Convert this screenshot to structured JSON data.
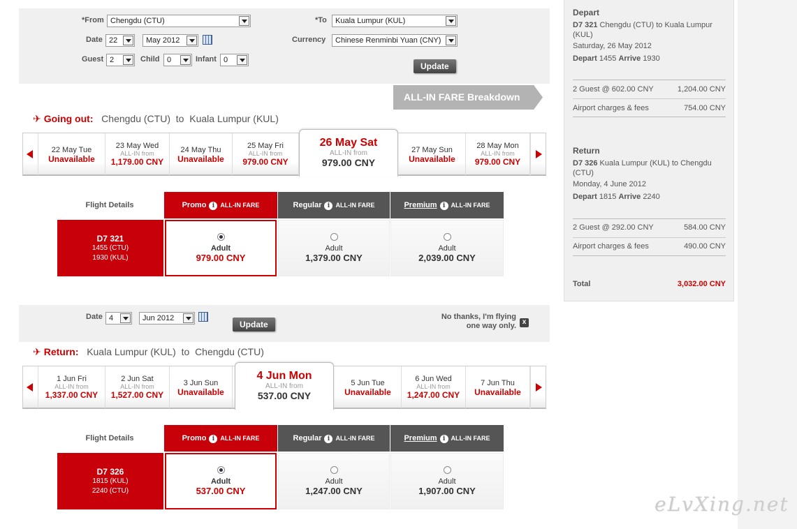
{
  "search": {
    "from_label": "*From",
    "from_value": "Chengdu (CTU)",
    "to_label": "*To",
    "to_value": "Kuala Lumpur (KUL)",
    "date_label": "Date",
    "date_day": "22",
    "date_month": "May 2012",
    "currency_label": "Currency",
    "currency_value": "Chinese Renminbi Yuan (CNY)",
    "guest_label": "Guest",
    "guest_value": "2",
    "child_label": "Child",
    "child_value": "0",
    "infant_label": "Infant",
    "infant_value": "0",
    "update": "Update"
  },
  "breakdown": "ALL-IN FARE Breakdown",
  "outbound": {
    "dir": "Going out:",
    "from": "Chengdu (CTU)",
    "to_word": "to",
    "to": "Kuala Lumpur (KUL)",
    "days": [
      {
        "d": "22 May Tue",
        "status": "Unavailable"
      },
      {
        "d": "23 May Wed",
        "af": "ALL-IN from",
        "price": "1,179.00 CNY"
      },
      {
        "d": "24 May Thu",
        "status": "Unavailable"
      },
      {
        "d": "25 May Fri",
        "af": "ALL-IN from",
        "price": "979.00 CNY"
      },
      {
        "d": "26 May Sat",
        "af": "ALL-IN from",
        "price": "979.00 CNY"
      },
      {
        "d": "27 May Sun",
        "status": "Unavailable"
      },
      {
        "d": "28 May Mon",
        "af": "ALL-IN from",
        "price": "979.00 CNY"
      }
    ],
    "flight_details": "Flight Details",
    "fares": [
      {
        "name": "Promo",
        "tag": "ALL-IN FARE"
      },
      {
        "name": "Regular",
        "tag": "ALL-IN FARE"
      },
      {
        "name": "Premium",
        "tag": "ALL-IN FARE"
      }
    ],
    "flight": {
      "no": "D7  321",
      "dep": "1455  (CTU)",
      "arr": "1930  (KUL)"
    },
    "cells": [
      {
        "pax": "Adult",
        "price": "979.00 CNY"
      },
      {
        "pax": "Adult",
        "price": "1,379.00 CNY"
      },
      {
        "pax": "Adult",
        "price": "2,039.00 CNY"
      }
    ]
  },
  "return_search": {
    "date_label": "Date",
    "date_day": "4",
    "date_month": "Jun 2012",
    "update": "Update",
    "no_thanks_1": "No thanks, I'm flying",
    "no_thanks_2": "one way only.",
    "close": "x"
  },
  "inbound": {
    "dir": "Return:",
    "from": "Kuala Lumpur (KUL)",
    "to_word": "to",
    "to": "Chengdu (CTU)",
    "days": [
      {
        "d": "1 Jun Fri",
        "af": "ALL-IN from",
        "price": "1,337.00 CNY"
      },
      {
        "d": "2 Jun Sat",
        "af": "ALL-IN from",
        "price": "1,527.00 CNY"
      },
      {
        "d": "3 Jun Sun",
        "status": "Unavailable"
      },
      {
        "d": "4 Jun Mon",
        "af": "ALL-IN from",
        "price": "537.00 CNY"
      },
      {
        "d": "5 Jun Tue",
        "status": "Unavailable"
      },
      {
        "d": "6 Jun Wed",
        "af": "ALL-IN from",
        "price": "1,247.00 CNY"
      },
      {
        "d": "7 Jun Thu",
        "status": "Unavailable"
      }
    ],
    "flight_details": "Flight Details",
    "fares": [
      {
        "name": "Promo",
        "tag": "ALL-IN FARE"
      },
      {
        "name": "Regular",
        "tag": "ALL-IN FARE"
      },
      {
        "name": "Premium",
        "tag": "ALL-IN FARE"
      }
    ],
    "flight": {
      "no": "D7  326",
      "dep": "1815  (KUL)",
      "arr": "2240  (CTU)"
    },
    "cells": [
      {
        "pax": "Adult",
        "price": "537.00 CNY"
      },
      {
        "pax": "Adult",
        "price": "1,247.00 CNY"
      },
      {
        "pax": "Adult",
        "price": "1,907.00 CNY"
      }
    ]
  },
  "summary": {
    "depart_h": "Depart",
    "depart_flight": "D7 321",
    "depart_route": "Chengdu (CTU) to Kuala Lumpur (KUL)",
    "depart_date": "Saturday, 26 May 2012",
    "depart_word": "Depart",
    "depart_time": "1455",
    "arrive_word": "Arrive",
    "arrive_time": "1930",
    "d_guest": "2 Guest @ 602.00 CNY",
    "d_guest_amt": "1,204.00 CNY",
    "d_airport": "Airport charges & fees",
    "d_airport_amt": "754.00 CNY",
    "return_h": "Return",
    "return_flight": "D7 326",
    "return_route": "Kuala Lumpur (KUL) to Chengdu (CTU)",
    "return_date": "Monday, 4 June 2012",
    "r_depart_time": "1815",
    "r_arrive_time": "2240",
    "r_guest": "2 Guest @ 292.00 CNY",
    "r_guest_amt": "584.00 CNY",
    "r_airport": "Airport charges & fees",
    "r_airport_amt": "490.00 CNY",
    "total": "Total",
    "total_amt": "3,032.00 CNY"
  },
  "watermark": "eLvXing.net"
}
